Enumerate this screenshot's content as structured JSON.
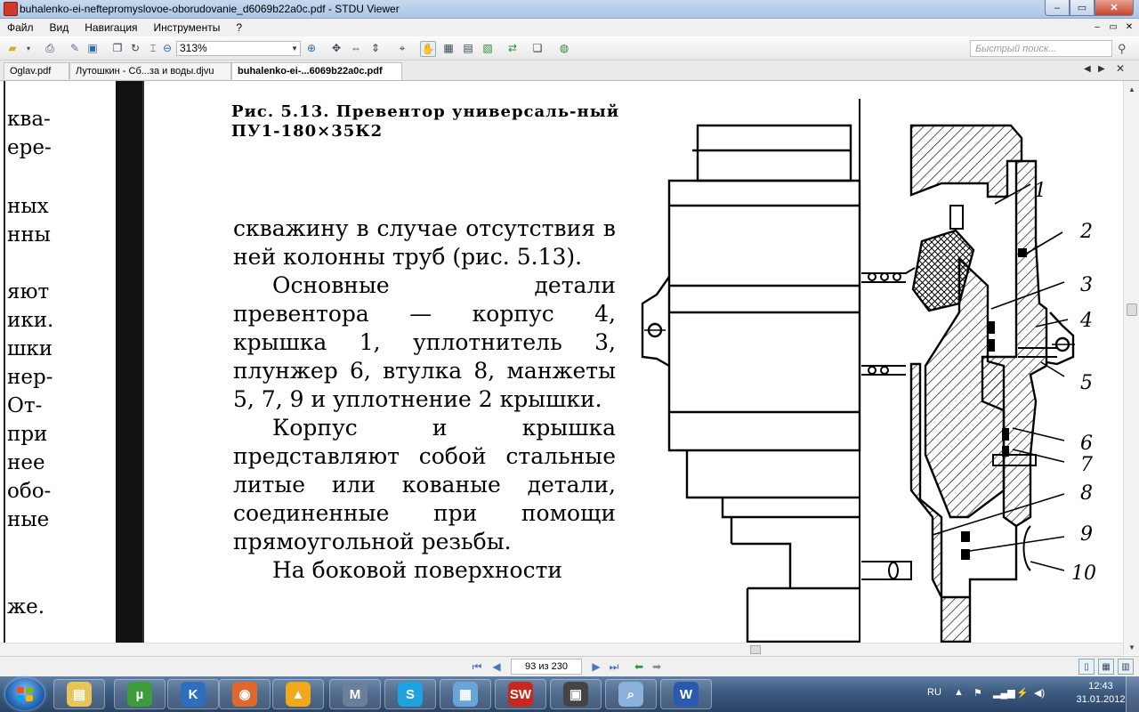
{
  "window": {
    "title": "buhalenko-ei-neftepromyslovoe-oborudovanie_d6069b22a0c.pdf - STDU Viewer",
    "minimize": "‒",
    "maximize": "▭",
    "close": "✕"
  },
  "menu": {
    "items": [
      "Файл",
      "Вид",
      "Навигация",
      "Инструменты",
      "?"
    ],
    "right_controls": [
      "‒",
      "▭",
      "✕"
    ]
  },
  "toolbar": {
    "zoom_value": "313%",
    "search_placeholder": "Быстрый поиск..."
  },
  "tabs": [
    {
      "label": "Oglav.pdf",
      "active": false
    },
    {
      "label": "Лутошкин - Сб...за и воды.djvu",
      "active": false
    },
    {
      "label": "buhalenko-ei-...6069b22a0c.pdf",
      "active": true
    }
  ],
  "document": {
    "left_column_fragments": [
      "ква-",
      "ере-",
      "ных",
      "нны",
      "яют",
      "ики.",
      "шки",
      "нер-",
      "От-",
      "при",
      "нее",
      "обо-",
      "ные",
      "же."
    ],
    "figure_caption": "Рис. 5.13. Превентор универсаль-ный ПУ1-180×35К2",
    "paragraphs": [
      "скважину в случае отсутствия в ней колонны труб (рис. 5.13).",
      "Основные детали превентора — корпус 4, крышка 1, уплотнитель 3, плунжер 6, втулка 8, манжеты 5, 7, 9 и уплотнение 2 крышки.",
      "Корпус и крышка представляют собой стальные литые или кованые детали, соединенные при помощи прямоугольной резьбы.",
      "На боковой поверхности"
    ],
    "callout_numbers": [
      "1",
      "2",
      "3",
      "4",
      "5",
      "6",
      "7",
      "8",
      "9",
      "10"
    ]
  },
  "statusbar": {
    "page_indicator": "93 из 230"
  },
  "taskbar": {
    "apps": [
      {
        "name": "explorer",
        "glyph": "▤",
        "color": "#e8c55a"
      },
      {
        "name": "utorrent",
        "glyph": "µ",
        "color": "#3e9c3a"
      },
      {
        "name": "k-app",
        "glyph": "K",
        "color": "#2c6fbf"
      },
      {
        "name": "firefox",
        "glyph": "◉",
        "color": "#e0682a"
      },
      {
        "name": "warning-app",
        "glyph": "▲",
        "color": "#f0a81c"
      },
      {
        "name": "m-app",
        "glyph": "M",
        "color": "#6a7f9a"
      },
      {
        "name": "skype",
        "glyph": "S",
        "color": "#1fa3e0"
      },
      {
        "name": "shell-app",
        "glyph": "▦",
        "color": "#6aa5d8"
      },
      {
        "name": "sw-app",
        "glyph": "SW",
        "color": "#c8281e"
      },
      {
        "name": "save-app",
        "glyph": "▣",
        "color": "#444"
      },
      {
        "name": "viewer-app",
        "glyph": "⌕",
        "color": "#8ab0dc"
      },
      {
        "name": "word",
        "glyph": "W",
        "color": "#2a5ab0"
      }
    ],
    "language": "RU",
    "time": "12:43",
    "date": "31.01.2012"
  }
}
